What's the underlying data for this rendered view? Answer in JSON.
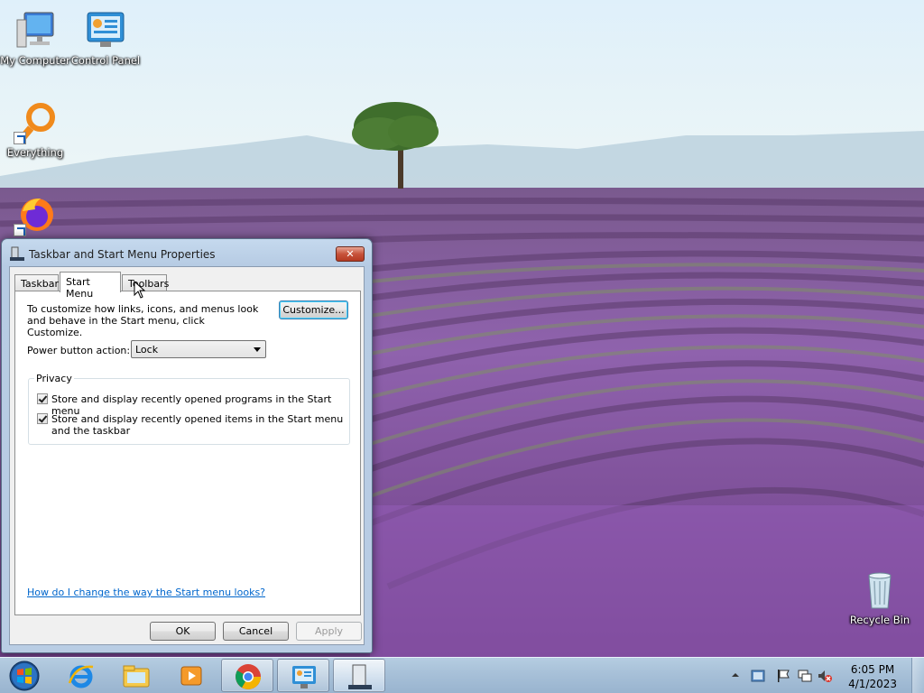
{
  "desktop": {
    "icons": [
      {
        "label": "My Computer"
      },
      {
        "label": "Control Panel"
      },
      {
        "label": "Everything"
      },
      {
        "label": ""
      },
      {
        "label": "Recycle Bin"
      }
    ]
  },
  "dialog": {
    "title": "Taskbar and Start Menu Properties",
    "close_label": "✕",
    "tabs": [
      {
        "label": "Taskbar"
      },
      {
        "label": "Start Menu"
      },
      {
        "label": "Toolbars"
      }
    ],
    "active_tab": "Start Menu",
    "description": "To customize how links, icons, and menus look and behave in the Start menu, click Customize.",
    "customize_label": "Customize...",
    "power_label": "Power button action:",
    "power_value": "Lock",
    "privacy": {
      "legend": "Privacy",
      "items": [
        {
          "label": "Store and display recently opened programs in the Start menu",
          "checked": true
        },
        {
          "label": "Store and display recently opened items in the Start menu and the taskbar",
          "checked": true
        }
      ]
    },
    "help_link": "How do I change the way the Start menu looks?",
    "buttons": {
      "ok": "OK",
      "cancel": "Cancel",
      "apply": "Apply"
    }
  },
  "taskbar": {
    "items": [
      "start-orb",
      "internet-explorer",
      "file-explorer",
      "media-player",
      "chrome",
      "control-panel",
      "taskbar-properties"
    ],
    "clock": {
      "time": "6:05 PM",
      "date": "4/1/2023"
    },
    "tray_icons": [
      "show-hidden-icons",
      "action-center",
      "flag-icon",
      "network-icon",
      "volume-muted-icon"
    ]
  },
  "colors": {
    "accent": "#3c7fb1",
    "link": "#0066cc",
    "lavender": "#8a5aa8"
  }
}
